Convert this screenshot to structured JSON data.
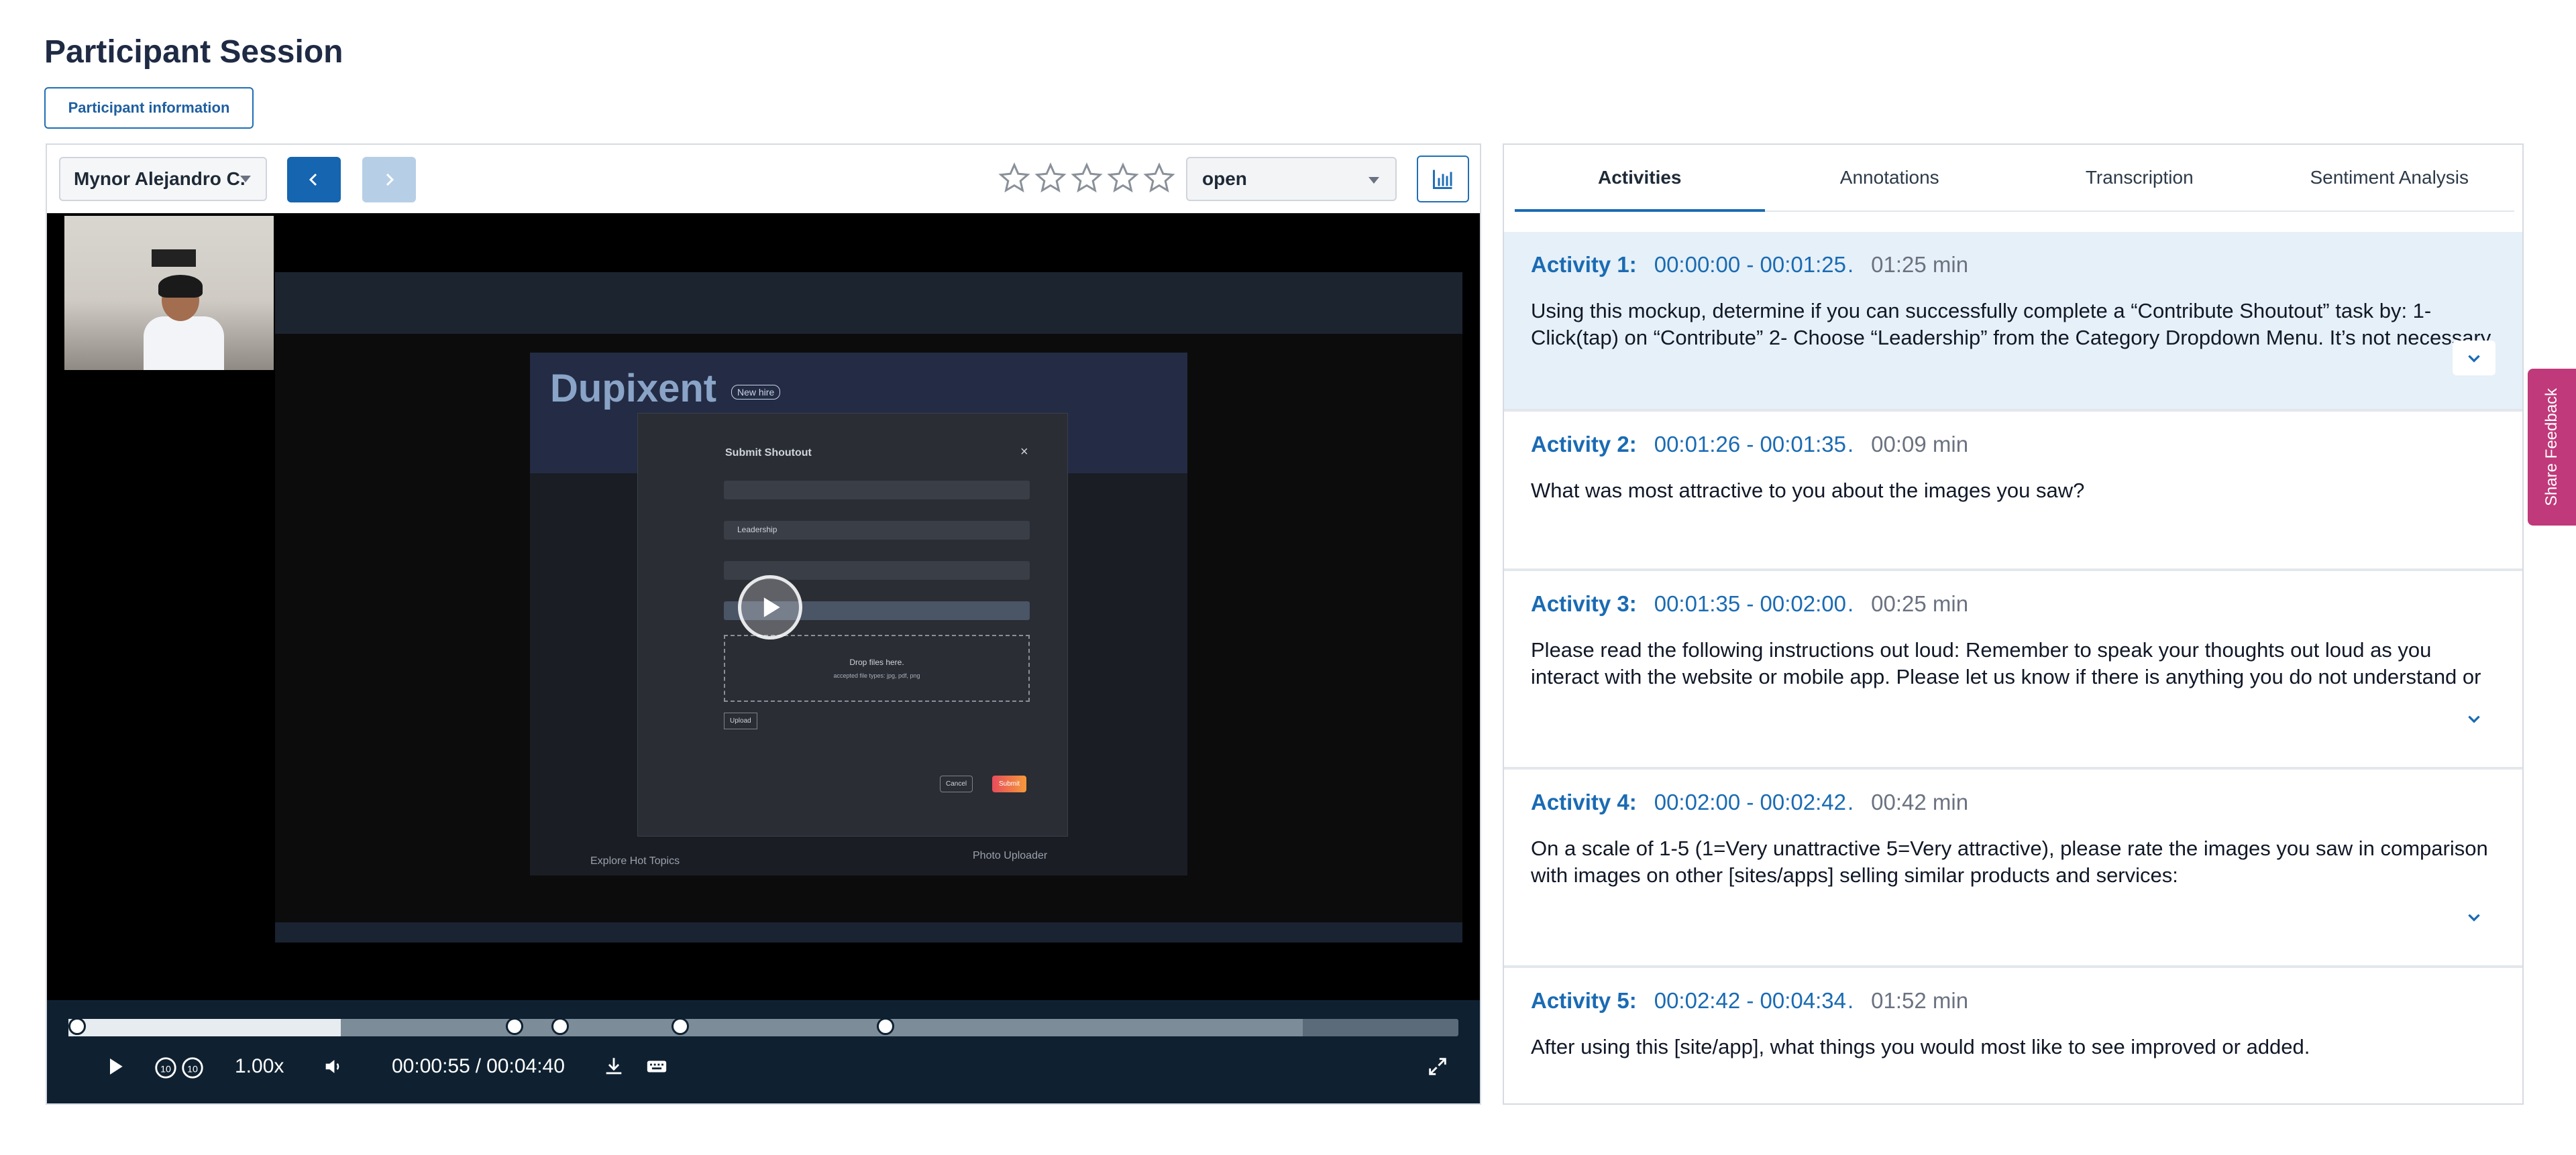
{
  "page": {
    "title": "Participant Session",
    "participant_info_button": "Participant information"
  },
  "player": {
    "participant_name": "Mynor Alejandro C.",
    "rating": {
      "value": 0,
      "max": 5
    },
    "status": "open",
    "playback_speed": "1.00x",
    "current_time": "00:00:55",
    "separator": "/",
    "total_time": "00:04:40",
    "progress_fraction": 0.196,
    "buffer_fraction": 0.888,
    "markers_time_fraction": [
      0,
      0.321,
      0.354,
      0.44,
      0.588
    ],
    "screen": {
      "app_title": "Dupixent",
      "badge": "New hire",
      "modal_title": "Submit Shoutout",
      "modal_category": "Leadership",
      "drop_text": "Drop files here.",
      "drop_subtext": "accepted file types: jpg, pdf, png",
      "upload": "Upload",
      "cancel": "Cancel",
      "submit": "Submit",
      "explore": "Explore Hot Topics",
      "photo_uploader": "Photo Uploader"
    }
  },
  "tabs": [
    {
      "label": "Activities",
      "active": true
    },
    {
      "label": "Annotations",
      "active": false
    },
    {
      "label": "Transcription",
      "active": false
    },
    {
      "label": "Sentiment Analysis",
      "active": false
    }
  ],
  "activities": [
    {
      "name": "Activity 1:",
      "range": "00:00:00 - 00:01:25",
      "sep": ".",
      "duration": "01:25 min",
      "text": "Using this mockup, determine if you can successfully complete a “Contribute Shoutout” task by: 1- Click(tap) on “Contribute” 2- Choose “Leadership” from the Category Dropdown Menu. It’s not necessary"
    },
    {
      "name": "Activity 2:",
      "range": "00:01:26 - 00:01:35",
      "sep": ".",
      "duration": "00:09 min",
      "text": "What was most attractive to you about the images you saw?"
    },
    {
      "name": "Activity 3:",
      "range": "00:01:35 - 00:02:00",
      "sep": ".",
      "duration": "00:25 min",
      "text": "Please read the following instructions out loud: Remember to speak your thoughts out loud as you interact with the website or mobile app. Please let us know if there is anything you do not understand or that"
    },
    {
      "name": "Activity 4:",
      "range": "00:02:00 - 00:02:42",
      "sep": ".",
      "duration": "00:42 min",
      "text": "On a scale of 1-5 (1=Very unattractive 5=Very attractive), please rate the images you saw in comparison with images on other [sites/apps] selling similar products and services:"
    },
    {
      "name": "Activity 5:",
      "range": "00:02:42 - 00:04:34",
      "sep": ".",
      "duration": "01:52 min",
      "text": "After using this [site/app], what things you would most like to see improved or added."
    }
  ],
  "feedback_tab": "Share Feedback",
  "colors": {
    "primary": "#1a6bb3",
    "feedback": "#c0397a",
    "highlight": "#e6f0f8",
    "player_bg": "#0f2131"
  }
}
